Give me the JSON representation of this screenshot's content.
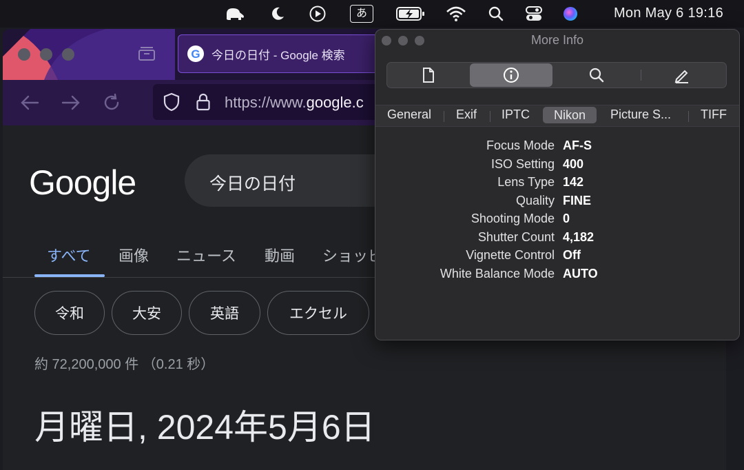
{
  "menubar": {
    "icons": [
      "elephant-icon",
      "moon-icon",
      "play-circle-icon",
      "input-method-icon",
      "battery-icon",
      "wifi-icon",
      "search-icon",
      "control-center-icon",
      "siri-icon"
    ],
    "input_method_label": "あ",
    "clock": "Mon May 6  19:16"
  },
  "browser": {
    "tab": {
      "title": "今日の日付 - Google 検索"
    },
    "url": {
      "prefix": "https://www.",
      "domain": "google.c"
    },
    "page": {
      "logo": "Google",
      "query": "今日の日付",
      "tabs": [
        "すべて",
        "画像",
        "ニュース",
        "動画",
        "ショッピ"
      ],
      "chips": [
        "令和",
        "大安",
        "英語",
        "エクセル"
      ],
      "result_count": "約 72,200,000 件 （0.21 秒）",
      "answer": "月曜日, 2024年5月6日"
    }
  },
  "more_info": {
    "title": "More Info",
    "toolbar": [
      "document-icon",
      "info-icon",
      "magnifier-icon",
      "pencil-icon"
    ],
    "tabs": [
      "General",
      "Exif",
      "IPTC",
      "Nikon",
      "Picture S...",
      "TIFF"
    ],
    "selected_tab": "Nikon",
    "rows": [
      {
        "key": "Focus Mode",
        "value": "AF-S"
      },
      {
        "key": "ISO Setting",
        "value": "400"
      },
      {
        "key": "Lens Type",
        "value": "142"
      },
      {
        "key": "Quality",
        "value": "FINE"
      },
      {
        "key": "Shooting Mode",
        "value": "0"
      },
      {
        "key": "Shutter Count",
        "value": "4,182"
      },
      {
        "key": "Vignette Control",
        "value": "Off"
      },
      {
        "key": "White Balance Mode",
        "value": "AUTO"
      }
    ]
  },
  "colors": {
    "google_blue_text": "#8ab4f8",
    "tab_purple": "#3b2068",
    "panel_bg": "#2a2a2c"
  }
}
